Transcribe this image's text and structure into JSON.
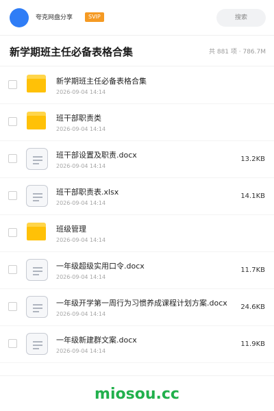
{
  "header": {
    "uploader": "夸克网盘分享",
    "badge": "SVIP",
    "search_placeholder": "搜索"
  },
  "share": {
    "title": "新学期班主任必备表格合集",
    "summary": "共 881 项 · 786.7M"
  },
  "files": [
    {
      "name": "新学期班主任必备表格合集",
      "date": "2026-09-04 14:14",
      "size": "",
      "type": "folder"
    },
    {
      "name": "班干部职责类",
      "date": "2026-09-04 14:14",
      "size": "",
      "type": "folder"
    },
    {
      "name": "班干部设置及职责.docx",
      "date": "2026-09-04 14:14",
      "size": "13.2KB",
      "type": "document"
    },
    {
      "name": "班干部职责表.xlsx",
      "date": "2026-09-04 14:14",
      "size": "14.1KB",
      "type": "document"
    },
    {
      "name": "班级管理",
      "date": "2026-09-04 14:14",
      "size": "",
      "type": "folder"
    },
    {
      "name": "一年级超级实用口令.docx",
      "date": "2026-09-04 14:14",
      "size": "11.7KB",
      "type": "document"
    },
    {
      "name": "一年级开学第一周行为习惯养成课程计划方案.docx",
      "date": "2026-09-04 14:14",
      "size": "24.6KB",
      "type": "document"
    },
    {
      "name": "一年级新建群文案.docx",
      "date": "2026-09-04 14:14",
      "size": "11.9KB",
      "type": "document"
    }
  ],
  "footer": {
    "watermark": "miosou.cc"
  },
  "colors": {
    "accent": "#2f7df6",
    "badge": "#f59a23",
    "folder": "#ffc107",
    "watermark": "#21b04c"
  }
}
